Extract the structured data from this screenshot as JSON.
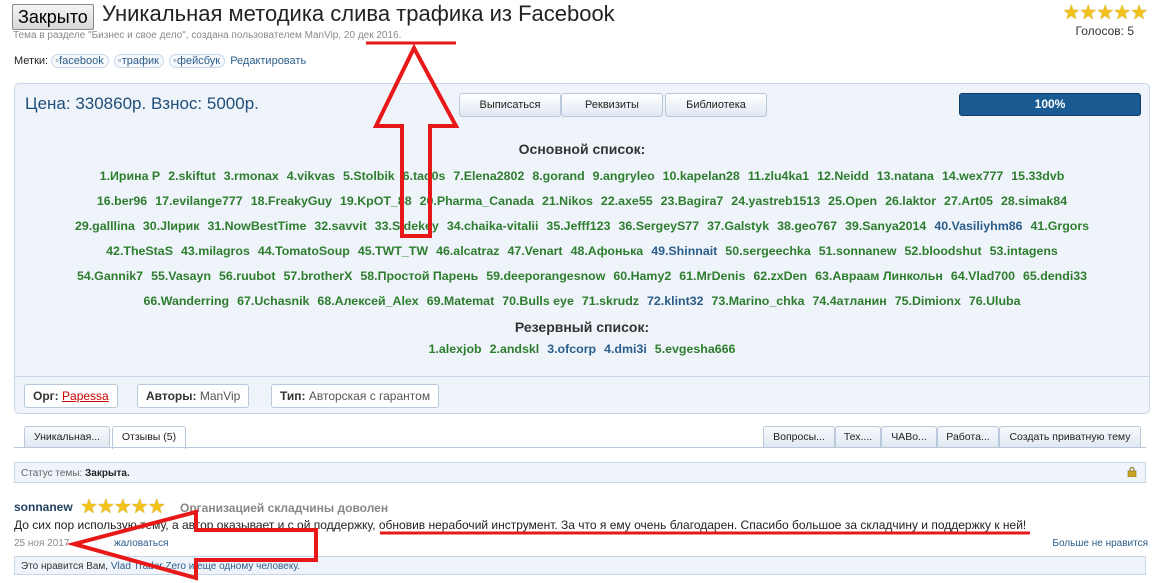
{
  "header": {
    "closed_button": "Закрыто",
    "title": "Уникальная методика слива трафика из Facebook",
    "subtitle": "Тема в разделе \"Бизнес и свое дело\", создана пользователем ManVip, 20 дек 2016.",
    "stars": "★★★★★",
    "votes": "Голосов: 5"
  },
  "tags": {
    "label": "Метки:",
    "items": [
      "facebook",
      "трафик",
      "фейсбук"
    ],
    "edit": "Редактировать"
  },
  "panel": {
    "price": "Цена: 330860р.   Взнос: 5000р.",
    "buttons": [
      "Выписаться",
      "Реквизиты",
      "Библиотека"
    ],
    "progress_label": "100%",
    "progress_value": 100,
    "main_list_title": "Основной список:",
    "main_list": [
      [
        "1.Ирина Р",
        "2.skiftut",
        "3.rmonax",
        "4.vikvas",
        "5.Stolbik",
        "6.tad0s",
        "7.Elena2802",
        "8.gorand",
        "9.angryleo",
        "10.kapelan28",
        "11.zlu4ka1",
        "12.Neidd",
        "13.natana",
        "14.wex777",
        "15.33dvb"
      ],
      [
        "16.ber96",
        "17.evilange777",
        "18.FreakyGuy",
        "19.KpOT_88",
        "20.Pharma_Canada",
        "21.Nikos",
        "22.axe55",
        "23.Bagira7",
        "24.yastreb1513",
        "25.Open",
        "26.laktor",
        "27.Art05",
        "28.simak84"
      ],
      [
        "29.galllina",
        "30.Jlирик",
        "31.NowBestTime",
        "32.savvit",
        "33.Sidekey",
        "34.chaika-vitalii",
        "35.Jefff123",
        "36.SergeyS77",
        "37.Galstyk",
        "38.geo767",
        "39.Sanya2014",
        "40.Vasiliyhm86",
        "41.Grgors"
      ],
      [
        "42.TheStaS",
        "43.milagros",
        "44.TomatoSoup",
        "45.TWT_TW",
        "46.alcatraz",
        "47.Venart",
        "48.Афонька",
        "49.Shinnait",
        "50.sergeechka",
        "51.sonnanew",
        "52.bloodshut",
        "53.intagens"
      ],
      [
        "54.Gannik7",
        "55.Vasayn",
        "56.ruubot",
        "57.brotherX",
        "58.Простой Парень",
        "59.deeporangesnow",
        "60.Hamy2",
        "61.MrDenis",
        "62.zxDen",
        "63.Авраам Линкольн",
        "64.Vlad700",
        "65.dendi33"
      ],
      [
        "66.Wanderring",
        "67.Uchasnik",
        "68.Алексей_Alex",
        "69.Matemat",
        "70.Bulls eye",
        "71.skrudz",
        "72.klint32",
        "73.Marino_chka",
        "74.4атланин",
        "75.Dimionx",
        "76.Uluba"
      ]
    ],
    "reserve_title": "Резервный список:",
    "reserve_list": [
      "1.alexjob",
      "2.andskl",
      "3.ofcorp",
      "4.dmi3i",
      "5.evgesha666"
    ]
  },
  "meta": {
    "org_label": "Орг:",
    "org_value": "Papessa",
    "authors_label": "Авторы:",
    "authors_value": "ManVip",
    "type_label": "Тип:",
    "type_value": "Авторская с гарантом"
  },
  "tabs": {
    "left": [
      "Уникальная...",
      "Отзывы (5)"
    ],
    "right": [
      "Вопросы...",
      "Тех....",
      "ЧАВо...",
      "Работа...",
      "Создать приватную тему"
    ]
  },
  "status": {
    "label": "Статус темы:",
    "value": "Закрыта."
  },
  "post": {
    "author": "sonnanew",
    "stars": "★★★★★",
    "title": "Организацией складчины доволен",
    "body": "До сих пор использую тему, а автор оказывает и с ой поддержку, обновив нерабочий инструмент. За что я ему очень благодарен. Спасибо большое за складчину и поддержку к ней!",
    "date": "25 ноя 2017",
    "report": "жаловаться",
    "unlike": "Больше не нравится"
  },
  "likes": {
    "prefix": "Это нравится Вам,",
    "users": "Vlad",
    "tail": "Trader Zero и еще одному человеку."
  },
  "colors": {
    "annotation_red": "#e81818",
    "progress_blue": "#1a5b93",
    "member_green": "#2e7d2e",
    "link_blue": "#2b5d8a"
  }
}
